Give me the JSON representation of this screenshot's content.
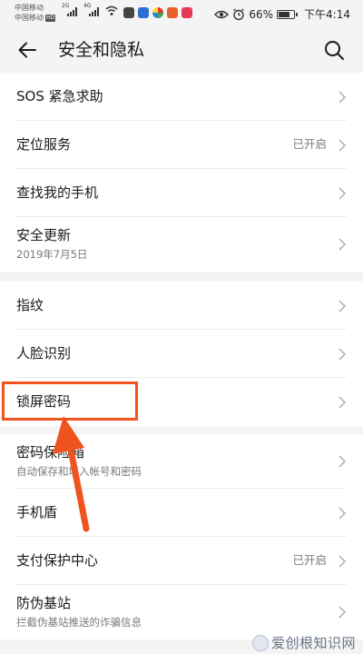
{
  "status_bar": {
    "carrier1": "中国移动",
    "carrier2": "中国移动",
    "carrier2_badge": "HD",
    "net1": "2G",
    "net2": "4G",
    "battery_percent": "66%",
    "battery_level": 0.66,
    "time": "下午4:14",
    "icons": [
      "signal-icon",
      "wifi-icon",
      "app-notification-icon",
      "eye-comfort-icon",
      "alarm-icon",
      "battery-icon"
    ]
  },
  "header": {
    "title": "安全和隐私",
    "back_icon": "arrow-left-icon",
    "search_icon": "search-icon"
  },
  "groups": [
    {
      "items": [
        {
          "label": "SOS 紧急求助",
          "sub": "",
          "status": ""
        },
        {
          "label": "定位服务",
          "sub": "",
          "status": "已开启"
        },
        {
          "label": "查找我的手机",
          "sub": "",
          "status": ""
        },
        {
          "label": "安全更新",
          "sub": "2019年7月5日",
          "status": ""
        }
      ]
    },
    {
      "items": [
        {
          "label": "指纹",
          "sub": "",
          "status": ""
        },
        {
          "label": "人脸识别",
          "sub": "",
          "status": ""
        },
        {
          "label": "锁屏密码",
          "sub": "",
          "status": ""
        }
      ]
    },
    {
      "items": [
        {
          "label": "密码保险箱",
          "sub": "自动保存和填入帐号和密码",
          "status": ""
        },
        {
          "label": "手机盾",
          "sub": "",
          "status": ""
        },
        {
          "label": "支付保护中心",
          "sub": "",
          "status": "已开启"
        },
        {
          "label": "防伪基站",
          "sub": "拦截伪基站推送的诈骗信息",
          "status": ""
        }
      ]
    }
  ],
  "annotation": {
    "highlighted_item": "锁屏密码",
    "color": "#f0541e"
  },
  "watermark": {
    "text": "爱创根知识网"
  },
  "colors": {
    "background": "#f4f4f4",
    "card": "#ffffff",
    "text_primary": "#1a1a1a",
    "text_secondary": "#7a7a7a",
    "accent_annotation": "#f0541e"
  }
}
